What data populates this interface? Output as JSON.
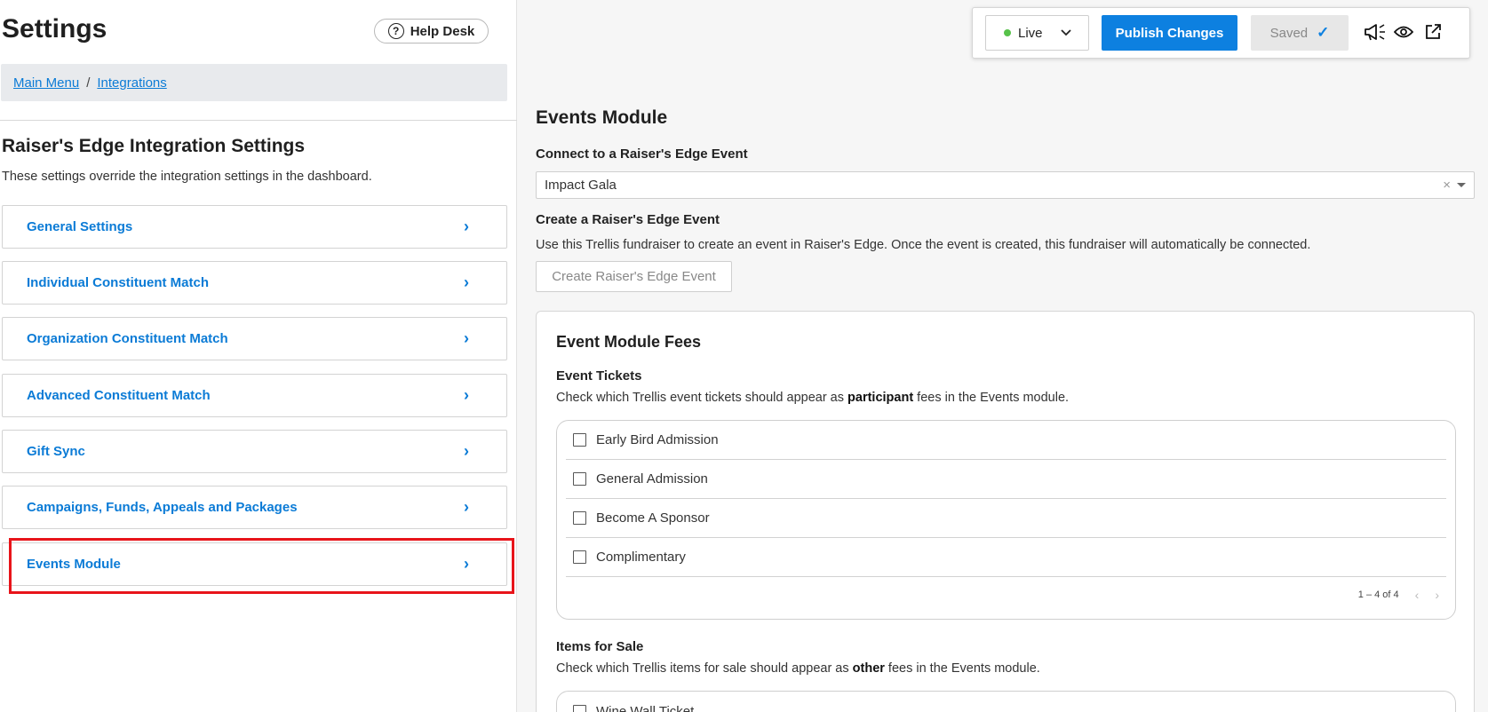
{
  "left": {
    "title": "Settings",
    "help_label": "Help Desk",
    "breadcrumb": [
      "Main Menu",
      "Integrations"
    ],
    "breadcrumb_sep": "/",
    "section_title": "Raiser's Edge Integration Settings",
    "section_sub": "These settings override the integration settings in the dashboard.",
    "nav": [
      {
        "label": "General Settings"
      },
      {
        "label": "Individual Constituent Match"
      },
      {
        "label": "Organization Constituent Match"
      },
      {
        "label": "Advanced Constituent Match"
      },
      {
        "label": "Gift Sync"
      },
      {
        "label": "Campaigns, Funds, Appeals and Packages"
      },
      {
        "label": "Events Module"
      }
    ]
  },
  "toolbar": {
    "status_label": "Live",
    "status_color": "#57c24a",
    "publish_label": "Publish Changes",
    "saved_label": "Saved",
    "icons": [
      "megaphone-icon",
      "eye-icon",
      "external-link-icon"
    ]
  },
  "main": {
    "title": "Events Module",
    "connect_label": "Connect to a Raiser's Edge Event",
    "connect_value": "Impact Gala",
    "create_label": "Create a Raiser's Edge Event",
    "create_desc": "Use this Trellis fundraiser to create an event in Raiser's Edge. Once the event is created, this fundraiser will automatically be connected.",
    "create_button": "Create Raiser's Edge Event",
    "fees": {
      "title": "Event Module Fees",
      "tickets_label": "Event Tickets",
      "tickets_desc_pre": "Check which Trellis event tickets should appear as ",
      "tickets_desc_bold": "participant",
      "tickets_desc_post": " fees in the Events module.",
      "tickets": [
        "Early Bird Admission",
        "General Admission",
        "Become A Sponsor",
        "Complimentary"
      ],
      "pager": "1 – 4 of 4",
      "items_label": "Items for Sale",
      "items_desc_pre": "Check which Trellis items for sale should appear as ",
      "items_desc_bold": "other",
      "items_desc_post": " fees in the Events module.",
      "items": [
        "Wine Wall Ticket"
      ]
    }
  },
  "accent_color": "#0d80e0",
  "highlight_color": "#e8141a"
}
